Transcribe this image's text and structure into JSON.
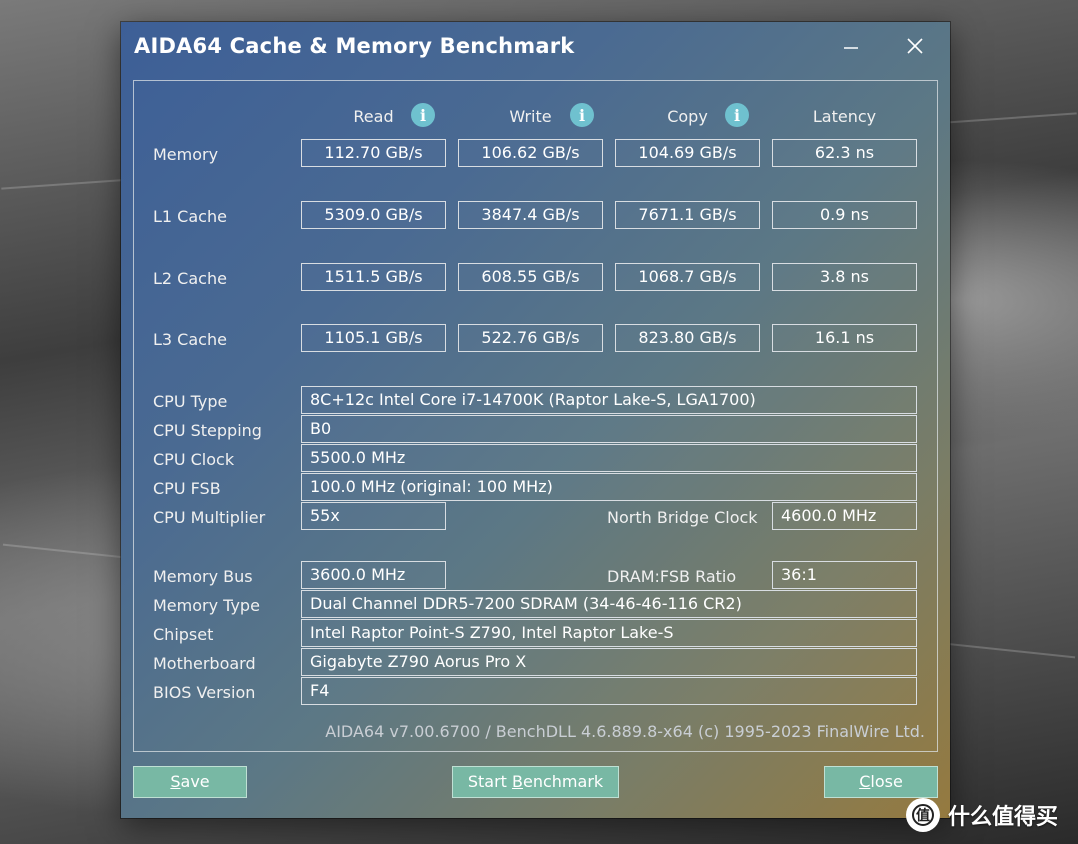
{
  "window": {
    "title": "AIDA64 Cache & Memory Benchmark",
    "minimize_icon": "minimize-icon",
    "close_icon": "close-icon"
  },
  "headers": {
    "read": "Read",
    "write": "Write",
    "copy": "Copy",
    "latency": "Latency",
    "info_icon": "i"
  },
  "bench": [
    {
      "label": "Memory",
      "read": "112.70 GB/s",
      "write": "106.62 GB/s",
      "copy": "104.69 GB/s",
      "latency": "62.3 ns"
    },
    {
      "label": "L1 Cache",
      "read": "5309.0 GB/s",
      "write": "3847.4 GB/s",
      "copy": "7671.1 GB/s",
      "latency": "0.9 ns"
    },
    {
      "label": "L2 Cache",
      "read": "1511.5 GB/s",
      "write": "608.55 GB/s",
      "copy": "1068.7 GB/s",
      "latency": "3.8 ns"
    },
    {
      "label": "L3 Cache",
      "read": "1105.1 GB/s",
      "write": "522.76 GB/s",
      "copy": "823.80 GB/s",
      "latency": "16.1 ns"
    }
  ],
  "cpu": {
    "type_label": "CPU Type",
    "type_value": "8C+12c Intel Core i7-14700K  (Raptor Lake-S, LGA1700)",
    "stepping_label": "CPU Stepping",
    "stepping_value": "B0",
    "clock_label": "CPU Clock",
    "clock_value": "5500.0 MHz",
    "fsb_label": "CPU FSB",
    "fsb_value": "100.0 MHz  (original: 100 MHz)",
    "multiplier_label": "CPU Multiplier",
    "multiplier_value": "55x",
    "nb_clock_label": "North Bridge Clock",
    "nb_clock_value": "4600.0 MHz"
  },
  "memory": {
    "bus_label": "Memory Bus",
    "bus_value": "3600.0 MHz",
    "ratio_label": "DRAM:FSB Ratio",
    "ratio_value": "36:1",
    "type_label": "Memory Type",
    "type_value": "Dual Channel DDR5-7200 SDRAM  (34-46-46-116 CR2)",
    "chipset_label": "Chipset",
    "chipset_value": "Intel Raptor Point-S Z790, Intel Raptor Lake-S",
    "motherboard_label": "Motherboard",
    "motherboard_value": "Gigabyte Z790 Aorus Pro X",
    "bios_label": "BIOS Version",
    "bios_value": "F4"
  },
  "footer": {
    "version": "AIDA64 v7.00.6700 / BenchDLL 4.6.889.8-x64  (c) 1995-2023 FinalWire Ltd."
  },
  "buttons": {
    "save_first": "S",
    "save_rest": "ave",
    "start_pre": "Start ",
    "start_u": "B",
    "start_post": "enchmark",
    "close_first": "C",
    "close_rest": "lose"
  },
  "watermark": {
    "text": "什么值得买",
    "logo_icon": "smzdm-logo-icon"
  },
  "colors": {
    "button_bg": "#78b8a4",
    "info_icon": "#6fc1cf",
    "border": "#d8dde2"
  }
}
